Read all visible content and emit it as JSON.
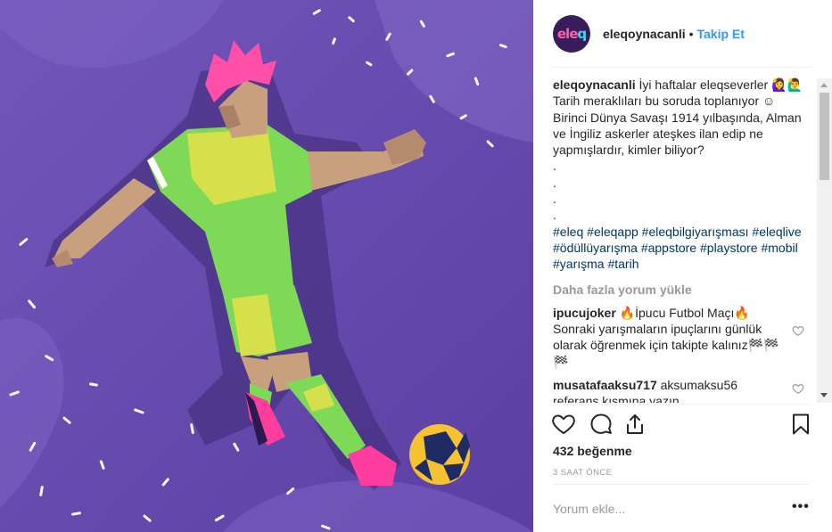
{
  "post": {
    "username": "eleqoynacanli",
    "separator": "•",
    "follow_label": "Takip Et",
    "avatar_text": "eleq"
  },
  "caption": {
    "username": "eleqoynacanli",
    "text": "İyi haftalar eleqseverler 🙋‍♀️🙋‍♂️ Tarih meraklıları bu soruda toplanıyor ☺ Birinci Dünya Savaşı 1914 yılbaşında, Alman ve İngiliz askerler ateşkes ilan edip ne yapmışlardır, kimler biliyor?\n.\n.\n.\n.",
    "hashtags": [
      "#eleq",
      "#eleqapp",
      "#eleqbilgiyarışması",
      "#eleqlive",
      "#ödüllüyarışma",
      "#appstore",
      "#playstore",
      "#mobil",
      "#yarışma",
      "#tarih"
    ]
  },
  "load_more_label": "Daha fazla yorum yükle",
  "comments": [
    {
      "username": "ipucujoker",
      "text": "🔥İpucu Futbol Maçı🔥 Sonraki yarışmaların ipuçlarını günlük olarak öğrenmek için takipte kalınız🏁🏁🏁"
    },
    {
      "username": "musatafaaksu717",
      "text": "aksumaksu56 referans kısmına yazın"
    }
  ],
  "likes_label": "432 beğenme",
  "timestamp": "3 SAAT ÖNCE",
  "add_comment_placeholder": "Yorum ekle...",
  "more_label": "•••",
  "icons": [
    "heart-icon",
    "comment-icon",
    "share-icon",
    "bookmark-icon",
    "more-options-icon"
  ],
  "colors": {
    "accent": "#3897f0",
    "hashtag": "#003569",
    "muted": "#999999",
    "background_art": "#6a4fb0"
  }
}
